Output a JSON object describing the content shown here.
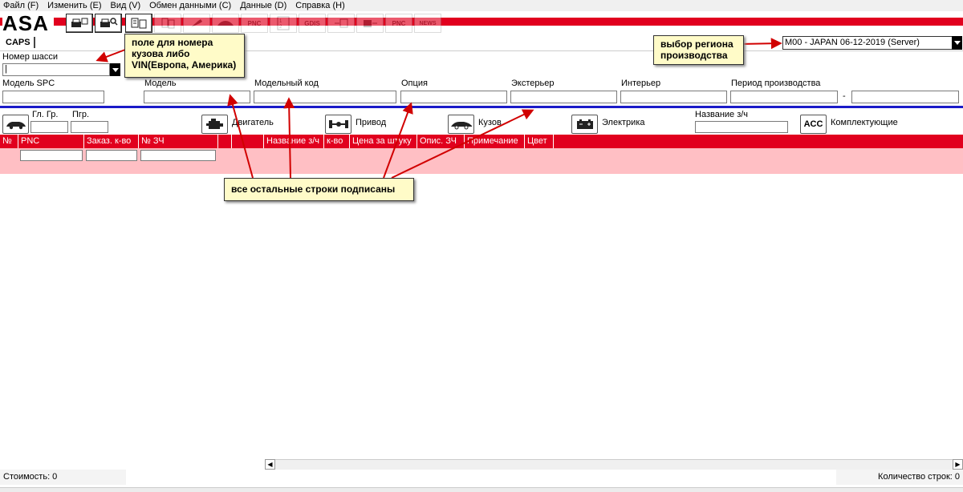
{
  "menu": [
    "Файл (F)",
    "Изменить (E)",
    "Вид (V)",
    "Обмен данными (C)",
    "Данные (D)",
    "Справка (H)"
  ],
  "app": {
    "logo": "ASA",
    "tab": "CAPS"
  },
  "toolbar": {
    "pnc1": "PNC",
    "gdis": "GDIS",
    "pnc2": "PNC",
    "news": "NEWS"
  },
  "chassis": {
    "label": "Номер шасси",
    "value": "|"
  },
  "region": {
    "value": "M00 - JAPAN 06-12-2019 (Server)"
  },
  "fields": {
    "spc": "Модель SPC",
    "model": "Модель",
    "model_code": "Модельный код",
    "option": "Опция",
    "exterior": "Экстерьер",
    "interior": "Интерьер",
    "period": "Период производства",
    "period_dash": "-"
  },
  "groups": {
    "main_group": "Гл. Гр.",
    "sub_group": "Пгр.",
    "engine": "Двигатель",
    "drive": "Привод",
    "body": "Кузов",
    "electric": "Электрика",
    "part_name": "Название з/ч",
    "acc_icon": "ACC",
    "accessories": "Комплектующие"
  },
  "table": {
    "columns": [
      "№",
      "PNC",
      "Заказ. к-во",
      "№ ЗЧ",
      "",
      "",
      "Название з/ч",
      "к-во",
      "Цена за штуку",
      "Опис. ЗЧ",
      "Примечание",
      "Цвет"
    ]
  },
  "callouts": {
    "chassis_note": "поле для номера\nкузова либо\nVIN(Европа, Америка)",
    "region_note": "выбор региона\nпроизводства",
    "rows_note": "все остальные строки подписаны"
  },
  "status": {
    "cost": "Стоимость: 0",
    "rows": "Количество строк: 0"
  },
  "colors": {
    "accent_red": "#e1001e",
    "filter_pink": "#ffbfc4",
    "divider_blue": "#1a1ac8",
    "note_bg": "#fffbc8"
  }
}
